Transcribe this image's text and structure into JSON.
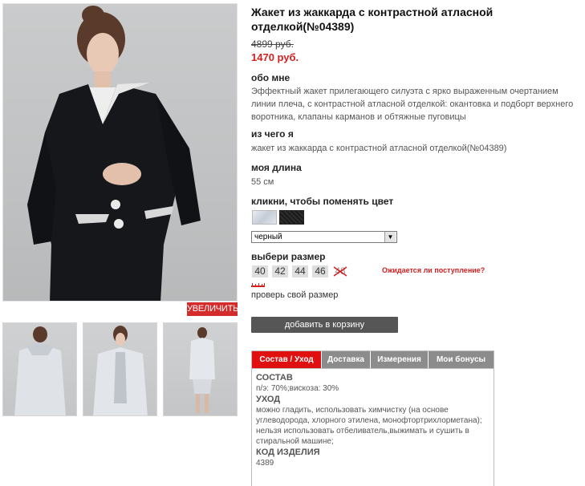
{
  "product": {
    "title": "Жакет из жаккарда с контрастной атласной отделкой(№04389)",
    "old_price": "4899 руб.",
    "new_price": "1470 руб."
  },
  "gallery": {
    "zoom_label": "УВЕЛИЧИТЬ"
  },
  "about": {
    "heading": "обо мне",
    "text": "Эффектный жакет прилегающего силуэта с ярко выраженным очертанием линии плеча, с контрастной атласной отделкой: окантовка и подборт верхнего воротника, клапаны карманов и обтяжные пуговицы"
  },
  "material": {
    "heading": "из чего я",
    "text": "жакет из жаккарда с контрастной атласной отделкой(№04389)"
  },
  "length": {
    "heading": "моя длина",
    "text": "55 см"
  },
  "color": {
    "heading": "кликни, чтобы поменять цвет",
    "selected": "черный",
    "swatches": [
      "silver",
      "black"
    ]
  },
  "size": {
    "heading": "выбери размер",
    "options": [
      "40",
      "42",
      "44",
      "46",
      "48"
    ],
    "unavailable": "48",
    "waiting_link": "Ожидается ли поступление?",
    "check_label": "проверь свой размер"
  },
  "cart": {
    "add_label": "добавить в корзину"
  },
  "tabs": {
    "items": [
      "Состав / Уход",
      "Доставка",
      "Измерения",
      "Мои бонусы"
    ],
    "active": "Состав / Уход",
    "composition_heading": "СОСТАВ",
    "composition_text": "п/э: 70%;вискоза: 30%",
    "care_heading": "УХОД",
    "care_text": "можно гладить, использовать химчистку (на основе углеводорода, хлорного этилена, монофтортрихлорметана); нельзя использовать отбеливатель,выжимать и сушить в стиральной машине;",
    "code_heading": "КОД ИЗДЕЛИЯ",
    "code_value": "4389"
  },
  "colors": {
    "accent_red": "#d32020",
    "tab_active": "#e01010",
    "tab_inactive": "#8c8c8c",
    "button_dark": "#565656"
  }
}
